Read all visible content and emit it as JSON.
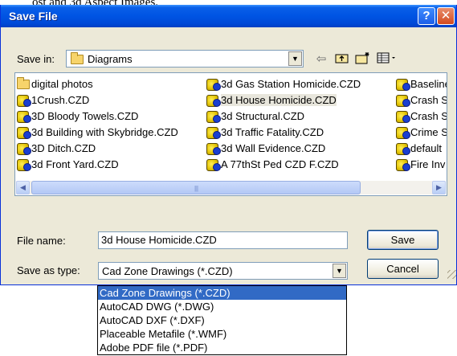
{
  "background_fragment": "ost and 3d Aspect Images.",
  "dialog": {
    "title": "Save File",
    "help_button": "?",
    "close_button": "✕"
  },
  "save_in": {
    "label": "Save in:",
    "folder": "Diagrams",
    "toolbar_icons": [
      "back-icon",
      "up-folder-icon",
      "new-folder-icon",
      "view-menu-icon"
    ]
  },
  "files": {
    "columns": [
      [
        {
          "name": "digital photos",
          "type": "folder"
        },
        {
          "name": "1Crush.CZD",
          "type": "czd"
        },
        {
          "name": "3D Bloody Towels.CZD",
          "type": "czd"
        },
        {
          "name": "3d Building with Skybridge.CZD",
          "type": "czd"
        },
        {
          "name": "3D Ditch.CZD",
          "type": "czd"
        },
        {
          "name": "3d Front Yard.CZD",
          "type": "czd"
        }
      ],
      [
        {
          "name": "3d Gas Station Homicide.CZD",
          "type": "czd"
        },
        {
          "name": "3d House Homicide.CZD",
          "type": "czd",
          "selected": true
        },
        {
          "name": "3d Structural.CZD",
          "type": "czd"
        },
        {
          "name": "3d Traffic Fatality.CZD",
          "type": "czd"
        },
        {
          "name": "3d Wall Evidence.CZD",
          "type": "czd"
        },
        {
          "name": "A 77thSt Ped CZD F.CZD",
          "type": "czd"
        }
      ],
      [
        {
          "name": "Baseline",
          "type": "czd"
        },
        {
          "name": "Crash S",
          "type": "czd"
        },
        {
          "name": "Crash S",
          "type": "czd"
        },
        {
          "name": "Crime S",
          "type": "czd"
        },
        {
          "name": "default",
          "type": "czd"
        },
        {
          "name": "Fire Inv",
          "type": "czd"
        }
      ]
    ]
  },
  "file_name": {
    "label": "File name:",
    "value": "3d House Homicide.CZD"
  },
  "save_as_type": {
    "label": "Save as type:",
    "value": "Cad Zone Drawings (*.CZD)",
    "options": [
      "Cad Zone Drawings (*.CZD)",
      "AutoCAD DWG (*.DWG)",
      "AutoCAD DXF (*.DXF)",
      "Placeable Metafile (*.WMF)",
      "Adobe PDF file (*.PDF)"
    ],
    "selected_index": 0
  },
  "buttons": {
    "save": "Save",
    "cancel": "Cancel"
  }
}
